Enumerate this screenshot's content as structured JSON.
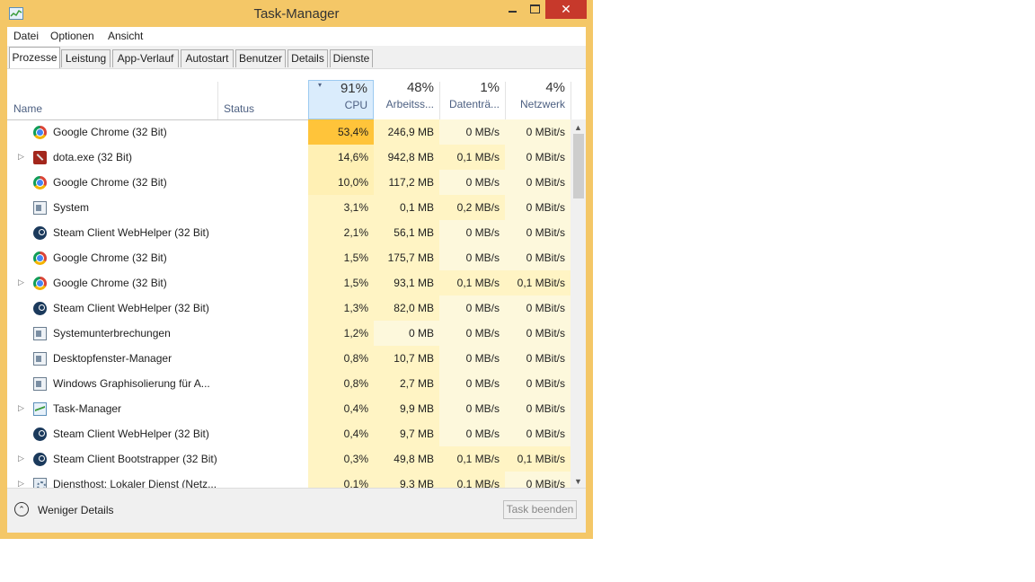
{
  "window": {
    "title": "Task-Manager",
    "close_glyph": "✕"
  },
  "menu": [
    "Datei",
    "Optionen",
    "Ansicht"
  ],
  "tabs": [
    "Prozesse",
    "Leistung",
    "App-Verlauf",
    "Autostart",
    "Benutzer",
    "Details",
    "Dienste"
  ],
  "active_tab": "Prozesse",
  "columns": {
    "name": "Name",
    "status": "Status",
    "cpu": {
      "pct": "91%",
      "label": "CPU",
      "sort_icon": "▾"
    },
    "memory": {
      "pct": "48%",
      "label": "Arbeitss..."
    },
    "disk": {
      "pct": "1%",
      "label": "Datenträ..."
    },
    "network": {
      "pct": "4%",
      "label": "Netzwerk"
    }
  },
  "processes": [
    {
      "name": "Google Chrome (32 Bit)",
      "icon": "chrome-icon",
      "expandable": false,
      "cpu": "53,4%",
      "memory": "246,9 MB",
      "disk": "0 MB/s",
      "network": "0 MBit/s"
    },
    {
      "name": "dota.exe (32 Bit)",
      "icon": "dota-icon",
      "expandable": true,
      "cpu": "14,6%",
      "memory": "942,8 MB",
      "disk": "0,1 MB/s",
      "network": "0 MBit/s"
    },
    {
      "name": "Google Chrome (32 Bit)",
      "icon": "chrome-icon",
      "expandable": false,
      "cpu": "10,0%",
      "memory": "117,2 MB",
      "disk": "0 MB/s",
      "network": "0 MBit/s"
    },
    {
      "name": "System",
      "icon": "system-icon",
      "expandable": false,
      "cpu": "3,1%",
      "memory": "0,1 MB",
      "disk": "0,2 MB/s",
      "network": "0 MBit/s"
    },
    {
      "name": "Steam Client WebHelper (32 Bit)",
      "icon": "steam-icon",
      "expandable": false,
      "cpu": "2,1%",
      "memory": "56,1 MB",
      "disk": "0 MB/s",
      "network": "0 MBit/s"
    },
    {
      "name": "Google Chrome (32 Bit)",
      "icon": "chrome-icon",
      "expandable": false,
      "cpu": "1,5%",
      "memory": "175,7 MB",
      "disk": "0 MB/s",
      "network": "0 MBit/s"
    },
    {
      "name": "Google Chrome (32 Bit)",
      "icon": "chrome-icon",
      "expandable": true,
      "cpu": "1,5%",
      "memory": "93,1 MB",
      "disk": "0,1 MB/s",
      "network": "0,1 MBit/s"
    },
    {
      "name": "Steam Client WebHelper (32 Bit)",
      "icon": "steam-icon",
      "expandable": false,
      "cpu": "1,3%",
      "memory": "82,0 MB",
      "disk": "0 MB/s",
      "network": "0 MBit/s"
    },
    {
      "name": "Systemunterbrechungen",
      "icon": "system-icon",
      "expandable": false,
      "cpu": "1,2%",
      "memory": "0 MB",
      "disk": "0 MB/s",
      "network": "0 MBit/s"
    },
    {
      "name": "Desktopfenster-Manager",
      "icon": "system-icon",
      "expandable": false,
      "cpu": "0,8%",
      "memory": "10,7 MB",
      "disk": "0 MB/s",
      "network": "0 MBit/s"
    },
    {
      "name": "Windows Graphisolierung für A...",
      "icon": "system-icon",
      "expandable": false,
      "cpu": "0,8%",
      "memory": "2,7 MB",
      "disk": "0 MB/s",
      "network": "0 MBit/s"
    },
    {
      "name": "Task-Manager",
      "icon": "task-manager-icon",
      "expandable": true,
      "cpu": "0,4%",
      "memory": "9,9 MB",
      "disk": "0 MB/s",
      "network": "0 MBit/s"
    },
    {
      "name": "Steam Client WebHelper (32 Bit)",
      "icon": "steam-icon",
      "expandable": false,
      "cpu": "0,4%",
      "memory": "9,7 MB",
      "disk": "0 MB/s",
      "network": "0 MBit/s"
    },
    {
      "name": "Steam Client Bootstrapper (32 Bit)",
      "icon": "steam-icon",
      "expandable": true,
      "cpu": "0,3%",
      "memory": "49,8 MB",
      "disk": "0,1 MB/s",
      "network": "0,1 MBit/s"
    },
    {
      "name": "Diensthost: Lokaler Dienst (Netz...",
      "icon": "service-icon",
      "expandable": true,
      "cpu": "0,1%",
      "memory": "9,3 MB",
      "disk": "0,1 MB/s",
      "network": "0 MBit/s"
    }
  ],
  "footer": {
    "less_details": "Weniger Details",
    "less_glyph": "⌃",
    "end_task": "Task beenden"
  },
  "scroll": {
    "up": "▲",
    "down": "▼"
  },
  "expander_glyph": "▷",
  "colors": {
    "frame": "#f4c767",
    "close": "#c7392b",
    "heat_high": "#ffc43a",
    "heat_mid": "#fff0b4",
    "heat_low": "#fff4c4",
    "heat_zero": "#fdf8dc",
    "selected_header": "#daecfc"
  }
}
